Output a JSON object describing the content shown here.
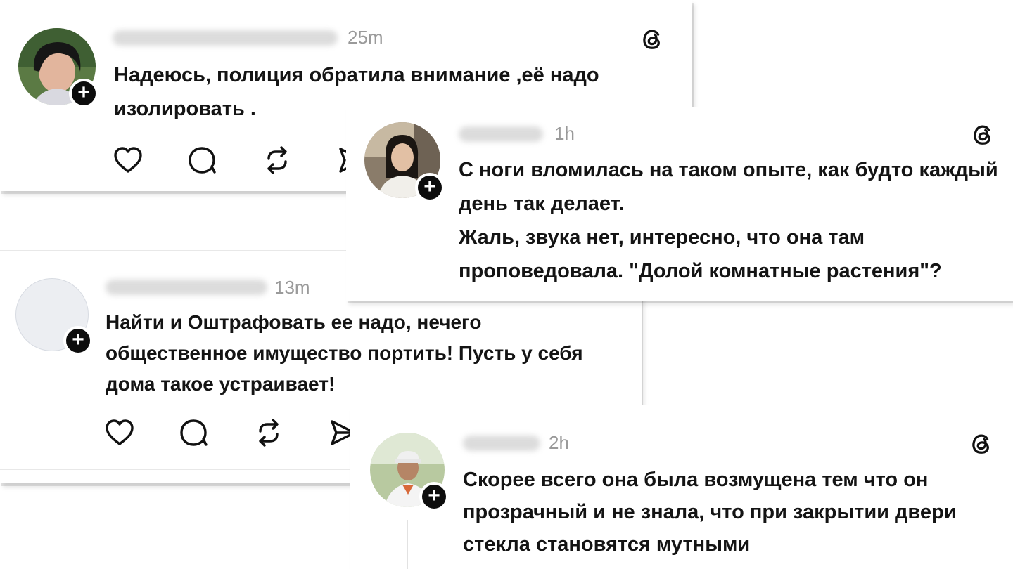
{
  "comments": [
    {
      "id": "c1",
      "time": "25m",
      "text": [
        "Надеюсь, полиция обратила внимание ,её надо изолировать ."
      ],
      "avatar": "woman-dark-hair-photo",
      "icons": [
        "heart-icon",
        "comment-icon",
        "repost-icon",
        "share-icon"
      ]
    },
    {
      "id": "c2",
      "time": "1h",
      "text": [
        "С ноги вломилась на таком опыте, как будто каждый день так делает.",
        "Жаль, звука нет, интересно, что она там проповедовала. \"Долой комнатные растения\"?"
      ],
      "avatar": "young-woman-photo"
    },
    {
      "id": "c3",
      "time": "13m",
      "text": [
        "Найти и Оштрафовать ее надо, нечего общественное имущество портить! Пусть у себя дома такое устраивает!"
      ],
      "avatar": "empty-avatar",
      "icons": [
        "heart-icon",
        "comment-icon",
        "repost-icon",
        "send-icon"
      ]
    },
    {
      "id": "c4",
      "time": "2h",
      "text": [
        "Скорее всего она была возмущена тем что он прозрачный и не знала, что при закрытии двери стекла становятся мутными"
      ],
      "avatar": "man-cap-photo"
    }
  ],
  "colors": {
    "text": "#141414",
    "muted": "#9a9a9a",
    "plus_badge": "#0d0d0d"
  }
}
